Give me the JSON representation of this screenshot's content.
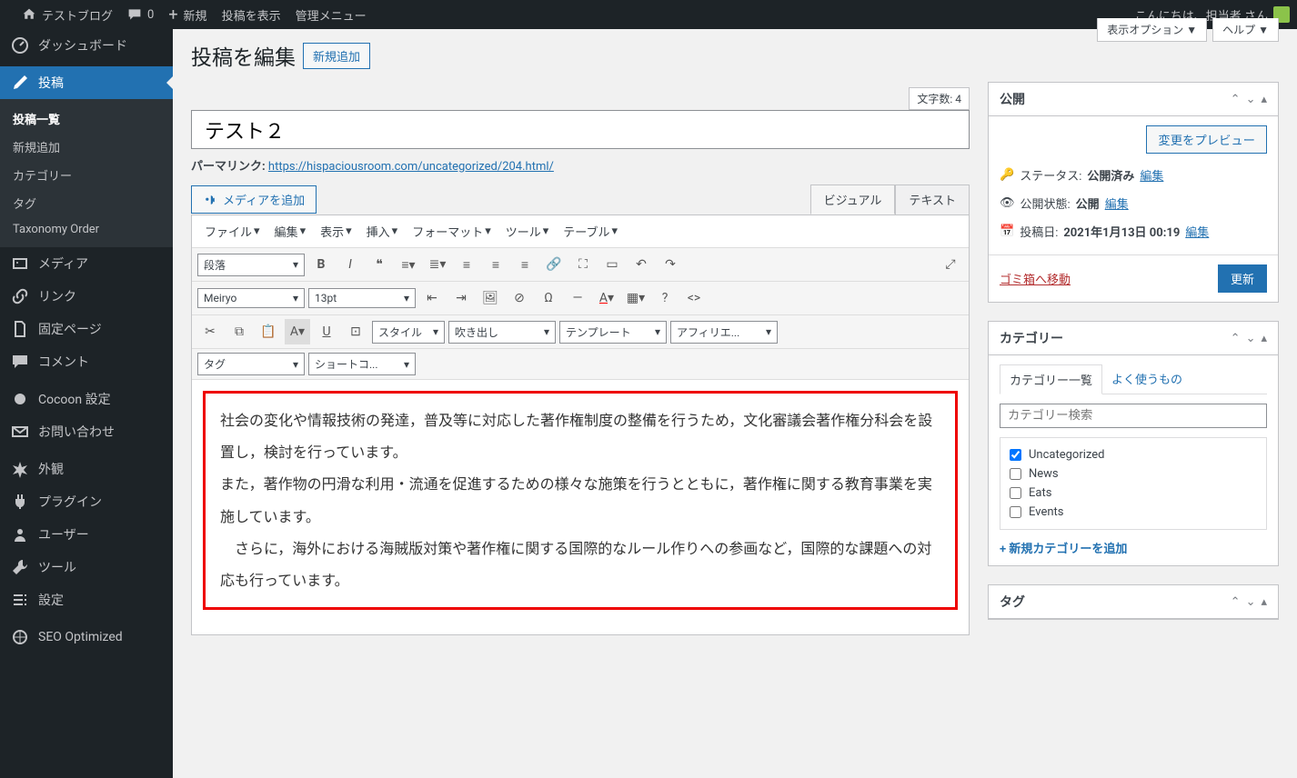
{
  "adminbar": {
    "site_name": "テストブログ",
    "comments": "0",
    "new": "新規",
    "view_post": "投稿を表示",
    "admin_menu": "管理メニュー",
    "greeting": "こんにちは、担当者 さん"
  },
  "sidebar": {
    "dashboard": "ダッシュボード",
    "posts": "投稿",
    "posts_sub": [
      "投稿一覧",
      "新規追加",
      "カテゴリー",
      "タグ",
      "Taxonomy Order"
    ],
    "media": "メディア",
    "links": "リンク",
    "pages": "固定ページ",
    "comments": "コメント",
    "cocoon": "Cocoon 設定",
    "contact": "お問い合わせ",
    "appearance": "外観",
    "plugins": "プラグイン",
    "users": "ユーザー",
    "tools": "ツール",
    "settings": "設定",
    "seo": "SEO Optimized"
  },
  "header": {
    "page_title": "投稿を編集",
    "add_new": "新規追加",
    "screen_options": "表示オプション",
    "help": "ヘルプ",
    "char_count_label": "文字数:",
    "char_count": "4"
  },
  "post": {
    "title": "テスト２",
    "permalink_label": "パーマリンク:",
    "permalink_url": "https://hispaciousroom.com/uncategorized/204.html/",
    "add_media": "メディアを追加",
    "tab_visual": "ビジュアル",
    "tab_text": "テキスト"
  },
  "menubar": [
    "ファイル",
    "編集",
    "表示",
    "挿入",
    "フォーマット",
    "ツール",
    "テーブル"
  ],
  "toolbar": {
    "format_select": "段落",
    "font_select": "Meiryo",
    "size_select": "13pt",
    "style_select": "スタイル",
    "balloon_select": "吹き出し",
    "template_select": "テンプレート",
    "affiliate_select": "アフィリエ...",
    "tag_select": "タグ",
    "shortcode_select": "ショートコ..."
  },
  "content": {
    "p1": "社会の変化や情報技術の発達，普及等に対応した著作権制度の整備を行うため，文化審議会著作権分科会を設置し，検討を行っています。",
    "p2": "また，著作物の円滑な利用・流通を促進するための様々な施策を行うとともに，著作権に関する教育事業を実施しています。",
    "p3": "　さらに，海外における海賊版対策や著作権に関する国際的なルール作りへの参画など，国際的な課題への対応も行っています。"
  },
  "publish": {
    "heading": "公開",
    "preview": "変更をプレビュー",
    "status_label": "ステータス:",
    "status_value": "公開済み",
    "visibility_label": "公開状態:",
    "visibility_value": "公開",
    "date_label": "投稿日:",
    "date_value": "2021年1月13日 00:19",
    "edit": "編集",
    "trash": "ゴミ箱へ移動",
    "update": "更新"
  },
  "categories": {
    "heading": "カテゴリー",
    "tab_all": "カテゴリー一覧",
    "tab_popular": "よく使うもの",
    "search_placeholder": "カテゴリー検索",
    "items": [
      {
        "label": "Uncategorized",
        "checked": true
      },
      {
        "label": "News",
        "checked": false
      },
      {
        "label": "Eats",
        "checked": false
      },
      {
        "label": "Events",
        "checked": false
      }
    ],
    "add_new": "+ 新規カテゴリーを追加"
  },
  "tags": {
    "heading": "タグ"
  }
}
